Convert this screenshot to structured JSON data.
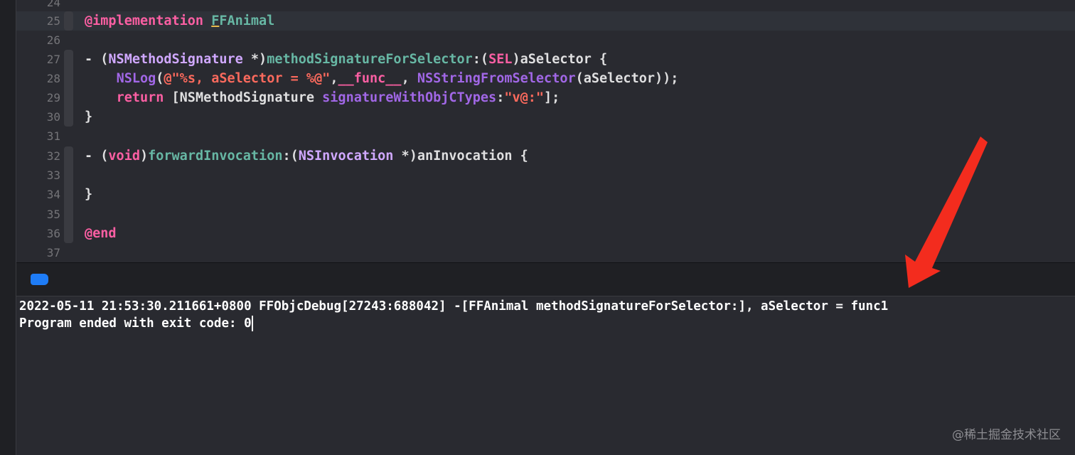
{
  "editor": {
    "lines": [
      {
        "num": "24"
      },
      {
        "num": "25",
        "kw": "@implementation",
        "sp": " ",
        "cls": "FFAnimal"
      },
      {
        "num": "26"
      },
      {
        "num": "27",
        "a": "- (",
        "b": "NSMethodSignature",
        "c": " *)",
        "d": "methodSignatureForSelector",
        "e": ":(",
        "f": "SEL",
        "g": ")aSelector {"
      },
      {
        "num": "28",
        "a": "    ",
        "b": "NSLog",
        "c": "(",
        "d": "@\"%s, aSelector = %@\"",
        "e": ",",
        "f": "__func__",
        "g": ", ",
        "h": "NSStringFromSelector",
        "i": "(aSelector));"
      },
      {
        "num": "29",
        "a": "    ",
        "b": "return",
        "c": " [NSMethodSignature ",
        "d": "signatureWithObjCTypes",
        "e": ":",
        "f": "\"v@:\"",
        "g": "];"
      },
      {
        "num": "30",
        "a": "}"
      },
      {
        "num": "31"
      },
      {
        "num": "32",
        "a": "- (",
        "b": "void",
        "c": ")",
        "d": "forwardInvocation",
        "e": ":(",
        "f": "NSInvocation",
        "g": " *)anInvocation {"
      },
      {
        "num": "33"
      },
      {
        "num": "34",
        "a": "}"
      },
      {
        "num": "35"
      },
      {
        "num": "36",
        "kw": "@end"
      },
      {
        "num": "37"
      }
    ]
  },
  "console": {
    "line1": "2022-05-11 21:53:30.211661+0800 FFObjcDebug[27243:688042] -[FFAnimal methodSignatureForSelector:], aSelector = func1",
    "line2": "Program ended with exit code: 0"
  },
  "watermark": "@稀土掘金技术社区",
  "colors": {
    "keyword": "#fc5fa3",
    "type": "#d0a8ff",
    "method": "#67b7a4",
    "string": "#fc6a5d",
    "accent": "#1e7cf6",
    "annotation_arrow": "#f32c1e"
  },
  "icons": {
    "debug_toggle": "sidebar-toggle-icon",
    "annotation": "red-arrow-annotation"
  }
}
